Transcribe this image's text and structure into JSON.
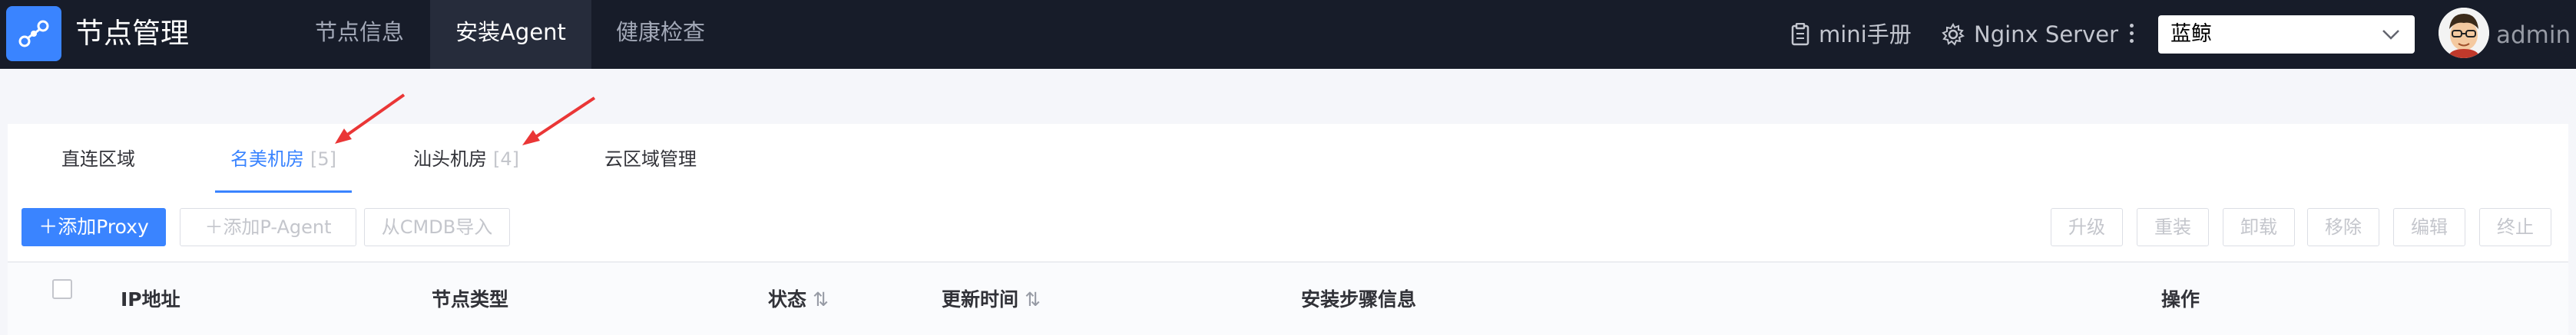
{
  "app": {
    "title": "节点管理"
  },
  "topnav": {
    "tabs": [
      {
        "label": "节点信息"
      },
      {
        "label": "安装Agent"
      },
      {
        "label": "健康检查"
      }
    ],
    "mini_manual": "mini手册",
    "server": "Nginx Server",
    "business_select": "蓝鲸",
    "user": "admin"
  },
  "region_tabs": [
    {
      "label": "直连区域",
      "count": ""
    },
    {
      "label": "名美机房",
      "count": "[5]"
    },
    {
      "label": "汕头机房",
      "count": "[4]"
    },
    {
      "label": "云区域管理",
      "count": ""
    }
  ],
  "toolbar": {
    "add_proxy": "添加Proxy",
    "add_pagent": "添加P-Agent",
    "import_cmdb": "从CMDB导入",
    "upgrade": "升级",
    "reinstall": "重装",
    "uninstall": "卸载",
    "remove": "移除",
    "edit": "编辑",
    "terminate": "终止"
  },
  "table": {
    "columns": {
      "ip": "IP地址",
      "node_type": "节点类型",
      "status": "状态",
      "updated": "更新时间",
      "steps": "安装步骤信息",
      "ops": "操作"
    },
    "sort_glyph": "⇅"
  },
  "colors": {
    "nav_bg": "#171c29",
    "accent": "#3a84ff",
    "arrow": "#ea3636"
  }
}
